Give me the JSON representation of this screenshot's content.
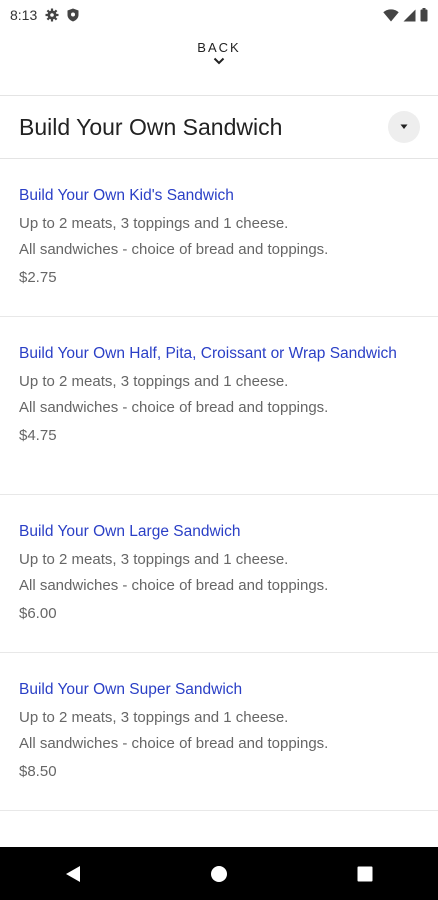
{
  "status_bar": {
    "time": "8:13",
    "icons": [
      "gear-icon",
      "shield-icon",
      "wifi-icon",
      "signal-icon",
      "battery-icon"
    ]
  },
  "header": {
    "back_label": "BACK"
  },
  "page": {
    "title": "Build Your Own Sandwich"
  },
  "items": [
    {
      "name": "Build Your Own Kid's Sandwich",
      "desc1": "Up to 2 meats, 3 toppings and 1 cheese.",
      "desc2": "All sandwiches - choice of bread and toppings.",
      "price": "$2.75"
    },
    {
      "name": "Build Your Own Half, Pita, Croissant or Wrap Sandwich",
      "desc1": "Up to 2 meats, 3 toppings and 1 cheese.",
      "desc2": "All sandwiches - choice of bread and toppings.",
      "price": "$4.75"
    },
    {
      "name": "Build Your Own Large Sandwich",
      "desc1": "Up to 2 meats, 3 toppings and 1 cheese.",
      "desc2": "All sandwiches - choice of bread and toppings.",
      "price": "$6.00"
    },
    {
      "name": "Build Your Own Super Sandwich",
      "desc1": "Up to 2 meats, 3 toppings and 1 cheese.",
      "desc2": "All sandwiches - choice of bread and toppings.",
      "price": "$8.50"
    }
  ],
  "nav_bar": {
    "buttons": [
      "back-triangle-icon",
      "home-circle-icon",
      "recents-square-icon"
    ]
  }
}
